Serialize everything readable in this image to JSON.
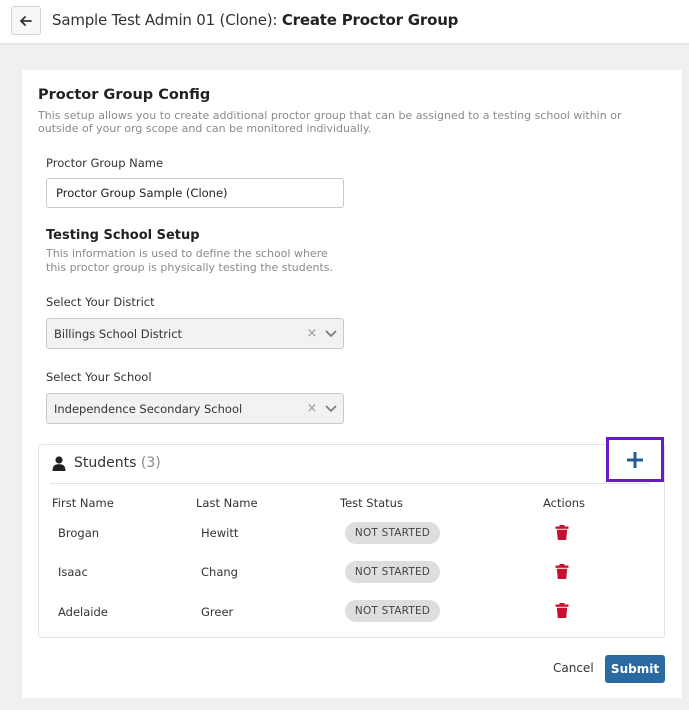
{
  "header": {
    "title_prefix": "Sample Test Admin 01 (Clone):",
    "title_main": "Create Proctor Group",
    "back_icon": "arrow-left-icon"
  },
  "config": {
    "title": "Proctor Group Config",
    "description": "This setup allows you to create additional proctor group that can be assigned to a testing school within or outside of your org scope and can be monitored individually.",
    "name_label": "Proctor Group Name",
    "name_value": "Proctor Group Sample (Clone)"
  },
  "school_setup": {
    "title": "Testing School Setup",
    "description": "This information is used to define the school where this proctor group is physically testing the students.",
    "district_label": "Select Your District",
    "district_value": "Billings School District",
    "school_label": "Select Your School",
    "school_value": "Independence Secondary School"
  },
  "students": {
    "title": "Students",
    "count": "(3)",
    "columns": [
      "First Name",
      "Last Name",
      "Test Status",
      "Actions"
    ],
    "rows": [
      {
        "first": "Brogan",
        "last": "Hewitt",
        "status": "NOT STARTED"
      },
      {
        "first": "Isaac",
        "last": "Chang",
        "status": "NOT STARTED"
      },
      {
        "first": "Adelaide",
        "last": "Greer",
        "status": "NOT STARTED"
      }
    ]
  },
  "footer": {
    "cancel_label": "Cancel",
    "submit_label": "Submit"
  },
  "colors": {
    "primary": "#2a6aa1",
    "highlight_border": "#6a19c9",
    "delete": "#c8102e",
    "badge_bg": "#dedede"
  }
}
